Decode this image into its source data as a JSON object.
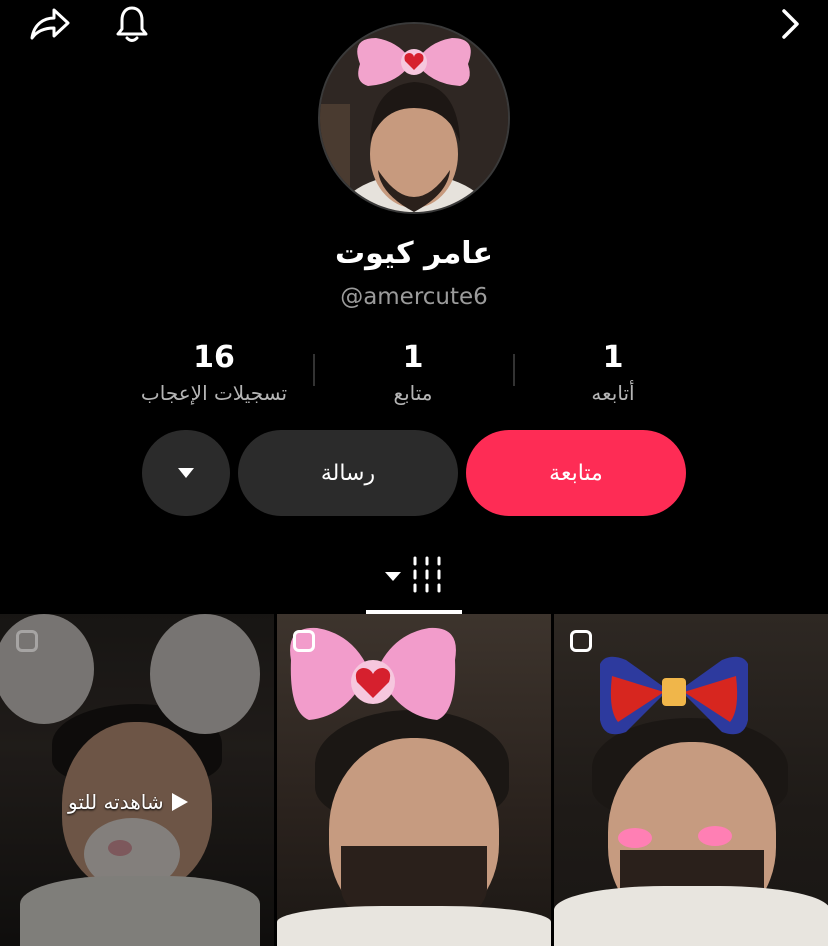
{
  "profile": {
    "display_name": "عامر كيوت",
    "username": "@amercute6"
  },
  "stats": [
    {
      "value": "1",
      "label": "أتابعه"
    },
    {
      "value": "1",
      "label": "متابع"
    },
    {
      "value": "16",
      "label": "تسجيلات الإعجاب"
    }
  ],
  "actions": {
    "follow_label": "متابعة",
    "message_label": "رسالة"
  },
  "videos": [
    {
      "overlay_text": "شاهدته للتو"
    }
  ],
  "colors": {
    "accent": "#fe2c55",
    "background": "#000000",
    "button_dark": "#2b2b2b",
    "secondary_text": "#9b9b9b"
  },
  "icons": [
    "share-icon",
    "bell-icon",
    "chevron-right-icon",
    "caret-down-icon",
    "grid-icon",
    "play-icon",
    "multi-clip-icon"
  ]
}
